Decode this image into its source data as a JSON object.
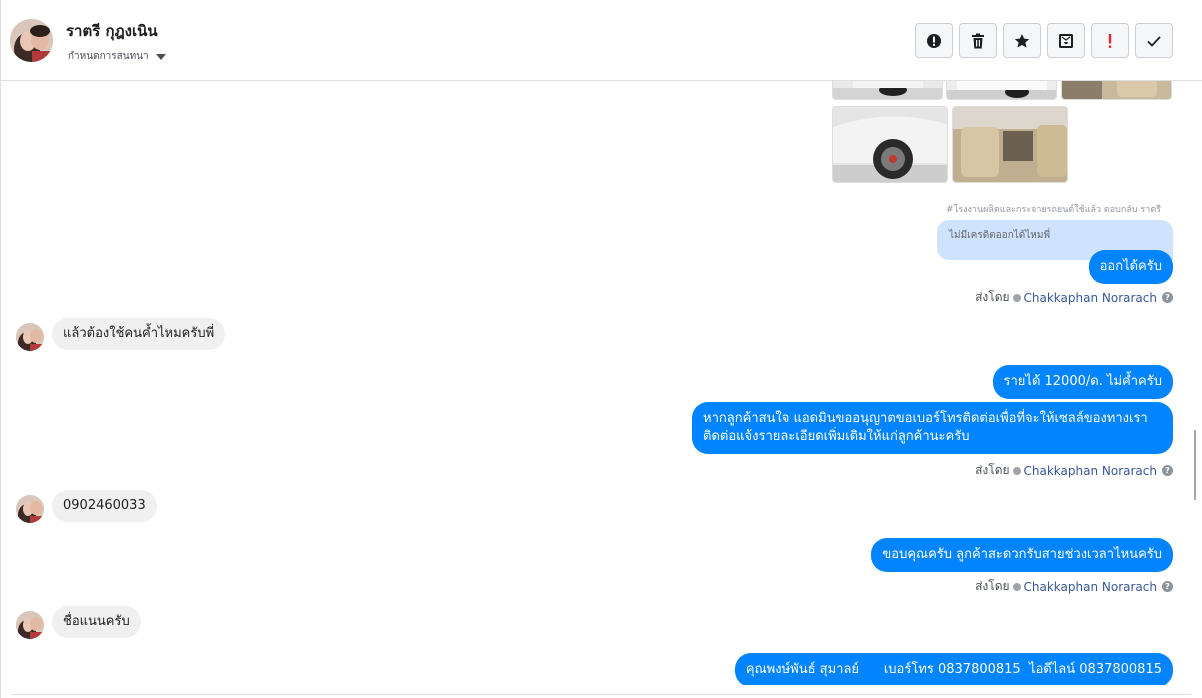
{
  "header": {
    "contact_name": "ราตรี กุฎงเนิน",
    "conversation_label": "กำหนดการสนทนา",
    "actions": [
      {
        "icon": "alert-circle-icon",
        "name": "mark-spam-button"
      },
      {
        "icon": "trash-icon",
        "name": "delete-button"
      },
      {
        "icon": "star-icon",
        "name": "star-button"
      },
      {
        "icon": "archive-icon",
        "name": "archive-button"
      },
      {
        "icon": "exclamation-icon",
        "name": "mark-important-button"
      },
      {
        "icon": "check-icon",
        "name": "mark-done-button"
      }
    ]
  },
  "thread": {
    "shared_post_note": "#โรงงานผลิตและกระจายรถยนต์ใช้แล้ว ตอบกลับ ราตรี",
    "quoted_message": "ไม่มีเครดิตออกได้ไหมพี่",
    "sent_by_label": "ส่งโดย",
    "agent_name": "Chakkaphan Norarach",
    "messages": [
      {
        "dir": "out",
        "text": "ออกได้ครับ"
      },
      {
        "dir": "in",
        "text": "แล้วต้องใช้คนค้ำไหมครับพี่"
      },
      {
        "dir": "out",
        "text": "รายได้ 12000/ด. ไม่ค้ำครับ"
      },
      {
        "dir": "out",
        "text": "หากลูกค้าสนใจ แอดมินขออนุญาตขอเบอร์โทรติดต่อเพื่อที่จะให้เซลล์ของทางเราติดต่อแจ้งรายละเอียดเพิ่มเติมให้แก่ลูกค้านะครับ"
      },
      {
        "dir": "in",
        "text": "0902460033"
      },
      {
        "dir": "out",
        "text": "ขอบคุณครับ ลูกค้าสะดวกรับสายช่วงเวลาไหนครับ"
      },
      {
        "dir": "in",
        "text": "ชื่อแนนครับ"
      },
      {
        "dir": "out",
        "text": "คุณพงษ์พันธ์ สุมาลย์      เบอร์โทร 0837800815  ไอดีไลน์ 0837800815"
      }
    ]
  },
  "colors": {
    "outgoing_bubble": "#0084ff",
    "incoming_bubble": "#f1f0f0",
    "quoted_bubble": "#cfe3ff",
    "agent_link": "#385898"
  }
}
